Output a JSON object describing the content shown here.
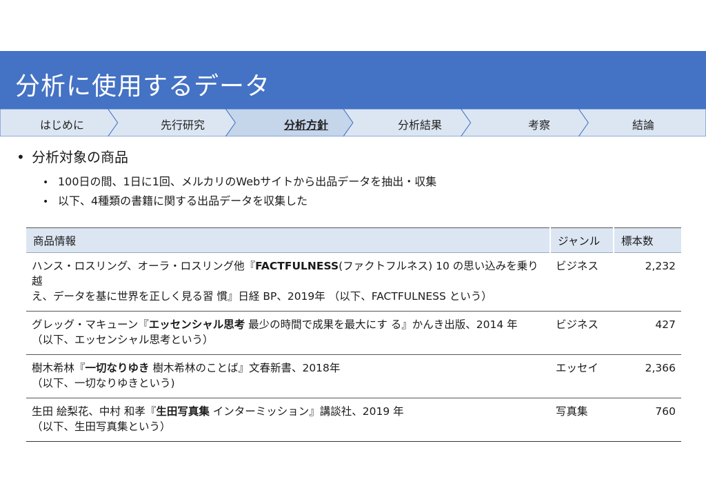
{
  "title": "分析に使用するデータ",
  "nav": {
    "items": [
      "はじめに",
      "先行研究",
      "分析方針",
      "分析結果",
      "考察",
      "結論"
    ],
    "active_index": 2,
    "colors": {
      "fill": "#dce6f2",
      "stroke": "#4472c4",
      "active_fill": "#c5d5ea"
    }
  },
  "bullets": {
    "main": "分析対象の商品",
    "subs": [
      "100日の間、1日に1回、メルカリのWebサイトから出品データを抽出・収集",
      "以下、4種類の書籍に関する出品データを収集した"
    ]
  },
  "table": {
    "headers": [
      "商品情報",
      "ジャンル",
      "標本数"
    ],
    "rows": [
      {
        "pre": "ハンス・ロスリング、オーラ・ロスリング他『",
        "bold": "FACTFULNESS",
        "post": "(ファクトフルネス) 10 の思い込みを乗り越",
        "line2": "え、データを基に世界を正しく見る習 慣』日経 BP、2019年 （以下、FACTFULNESS という）",
        "genre": "ビジネス",
        "count": "2,232"
      },
      {
        "pre": "グレッグ・マキューン『",
        "bold": "エッセンシャル思考",
        "post": " 最少の時間で成果を最大にす る』かんき出版、2014 年",
        "line2": "（以下、エッセンシャル思考という）",
        "genre": "ビジネス",
        "count": "427"
      },
      {
        "pre": "樹木希林『",
        "bold": "一切なりゆき",
        "post": " 樹木希林のことば』文春新書、2018年",
        "line2": "（以下、一切なりゆきという)",
        "genre": "エッセイ",
        "count": "2,366"
      },
      {
        "pre": "生田 絵梨花、中村 和孝『",
        "bold": "生田写真集",
        "post": " インターミッション』講談社、2019 年",
        "line2": "（以下、生田写真集という）",
        "genre": "写真集",
        "count": "760"
      }
    ]
  },
  "colors": {
    "title_bar": "#4472c4",
    "header_bg": "#dce6f2"
  }
}
